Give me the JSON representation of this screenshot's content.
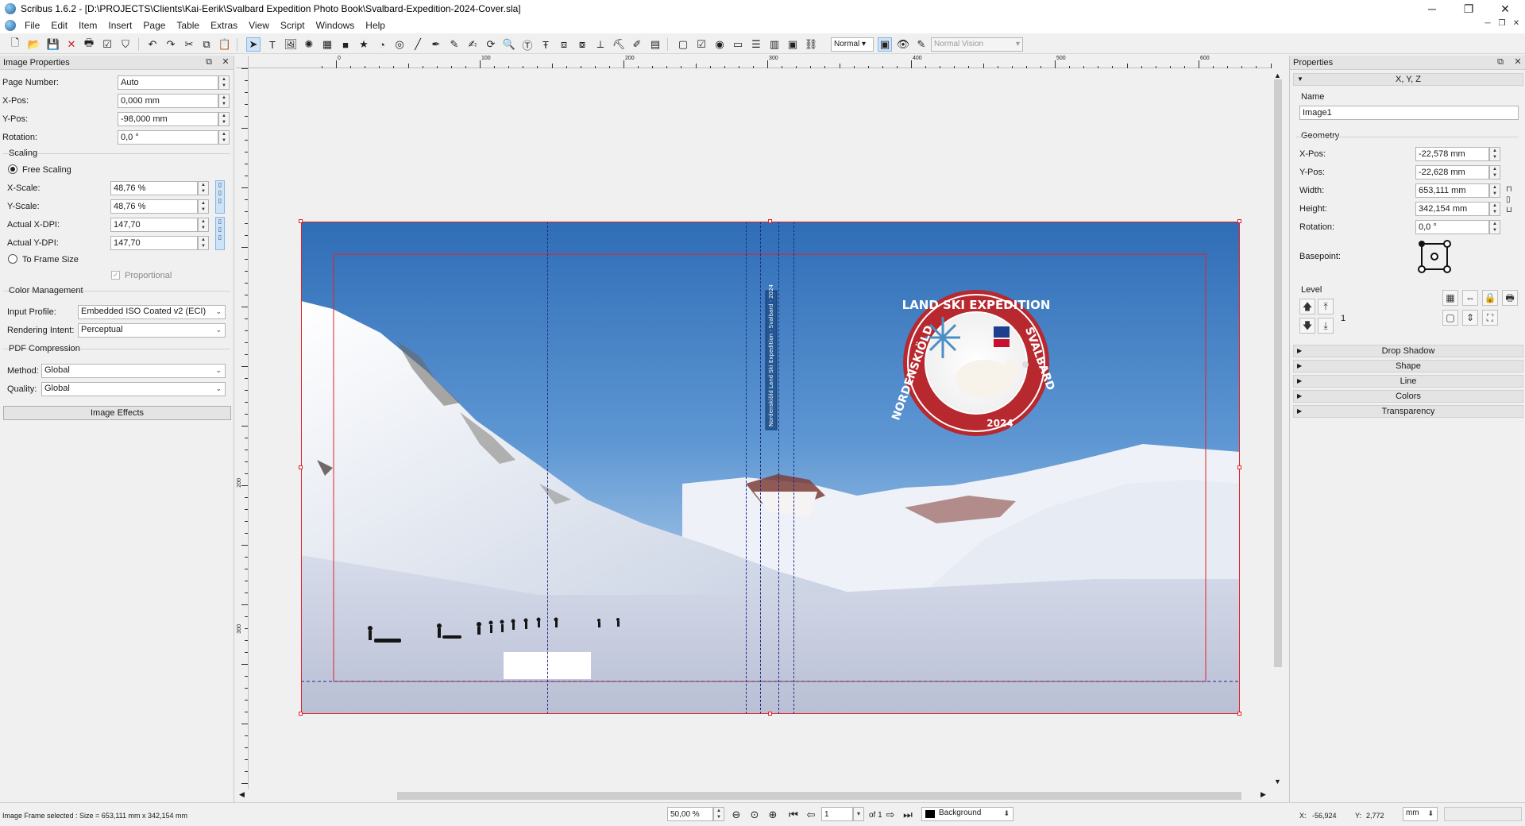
{
  "window": {
    "title": "Scribus 1.6.2 - [D:\\PROJECTS\\Clients\\Kai-Eerik\\Svalbard Expedition Photo Book\\Svalbard-Expedition-2024-Cover.sla]",
    "minimize": "─",
    "maximize": "❐",
    "close": "✕"
  },
  "menu": [
    "File",
    "Edit",
    "Item",
    "Insert",
    "Page",
    "Table",
    "Extras",
    "View",
    "Script",
    "Windows",
    "Help"
  ],
  "toolbar": {
    "mode_combo": "Normal",
    "vision_combo": "Normal Vision"
  },
  "image_properties": {
    "header": "Image Properties",
    "page_number_label": "Page Number:",
    "page_number_value": "Auto",
    "xpos_label": "X-Pos:",
    "xpos_value": "0,000 mm",
    "ypos_label": "Y-Pos:",
    "ypos_value": "-98,000 mm",
    "rotation_label": "Rotation:",
    "rotation_value": "0,0 °",
    "scaling_title": "Scaling",
    "free_scaling": "Free Scaling",
    "xscale_label": "X-Scale:",
    "xscale_value": "48,76 %",
    "yscale_label": "Y-Scale:",
    "yscale_value": "48,76 %",
    "xdpi_label": "Actual X-DPI:",
    "xdpi_value": "147,70",
    "ydpi_label": "Actual Y-DPI:",
    "ydpi_value": "147,70",
    "to_frame_size": "To Frame Size",
    "proportional": "Proportional",
    "color_mgmt_title": "Color Management",
    "input_profile_label": "Input Profile:",
    "input_profile_value": "Embedded ISO Coated v2 (ECI)",
    "rendering_intent_label": "Rendering Intent:",
    "rendering_intent_value": "Perceptual",
    "pdf_title": "PDF Compression",
    "method_label": "Method:",
    "method_value": "Global",
    "quality_label": "Quality:",
    "quality_value": "Global",
    "image_effects": "Image Effects"
  },
  "ruler": {
    "h_labels": [
      "0",
      "100",
      "200",
      "300",
      "400",
      "500",
      "600"
    ],
    "v_labels": [
      "200",
      "300"
    ]
  },
  "cover": {
    "spine_text": "Nordenskiöld Land Ski Expedition · Svalbard · 2024",
    "badge_text_top": "LAND SKI EXPEDITION",
    "badge_text_left": "NORDENSKIÖLD",
    "badge_text_right": "SVALBARD",
    "badge_year": "2024"
  },
  "properties": {
    "header": "Properties",
    "tab_xyz": "X, Y, Z",
    "name_label": "Name",
    "name_value": "Image1",
    "geometry_title": "Geometry",
    "xpos_label": "X-Pos:",
    "xpos_value": "-22,578 mm",
    "ypos_label": "Y-Pos:",
    "ypos_value": "-22,628 mm",
    "width_label": "Width:",
    "width_value": "653,111 mm",
    "height_label": "Height:",
    "height_value": "342,154 mm",
    "rotation_label": "Rotation:",
    "rotation_value": "0,0 °",
    "basepoint_label": "Basepoint:",
    "level_title": "Level",
    "level_value": "1",
    "sections": [
      "Drop Shadow",
      "Shape",
      "Line",
      "Colors",
      "Transparency"
    ]
  },
  "status": {
    "message": "Image Frame selected : Size = 653,111 mm x 342,154 mm",
    "zoom": "50,00 %",
    "page": "1",
    "of_pages": "of 1",
    "layer": "Background",
    "x_label": "X:",
    "x_value": "-56,924",
    "y_label": "Y:",
    "y_value": "2,772",
    "unit": "mm"
  },
  "colors": {
    "selection_red": "#e3202a",
    "guide_blue": "#1b2a8c",
    "badge_red": "#b8282f",
    "sky_top": "#2e6eb8",
    "sky_bottom": "#a9c7e6"
  }
}
